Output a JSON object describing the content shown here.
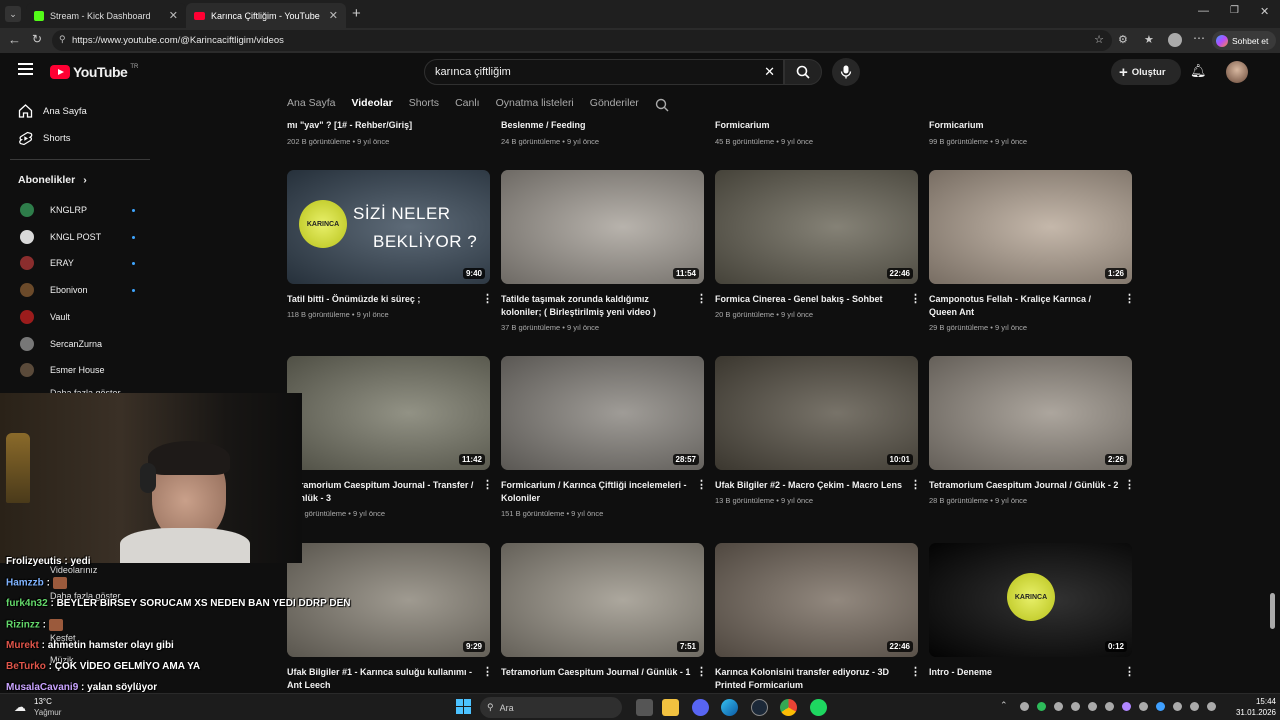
{
  "browser": {
    "tabs": [
      {
        "title": "Stream - Kick Dashboard",
        "active": false
      },
      {
        "title": "Karınca Çiftliğim - YouTube",
        "active": true
      }
    ],
    "url": "https://www.youtube.com/@Karincaciftligim/videos",
    "profile_button": "Sohbet et"
  },
  "masthead": {
    "logo": "YouTube",
    "region": "TR",
    "search_value": "karınca çiftliğim",
    "create_label": "Oluştur"
  },
  "sidebar": {
    "items": [
      {
        "label": "Ana Sayfa"
      },
      {
        "label": "Shorts"
      }
    ],
    "subs_header": "Abonelikler",
    "subs": [
      {
        "name": "KNGLRP",
        "color": "#2e7d4a",
        "dot": true
      },
      {
        "name": "KNGL POST",
        "color": "#d9d9d9",
        "dot": true
      },
      {
        "name": "ERAY",
        "color": "#8a2d2d",
        "dot": true
      },
      {
        "name": "Ebonivon",
        "color": "#6b4a2a",
        "dot": true
      },
      {
        "name": "Vault",
        "color": "#9b1c1c",
        "dot": false
      },
      {
        "name": "SercanZurna",
        "color": "#777777",
        "dot": false
      },
      {
        "name": "Esmer House",
        "color": "#5a4a3a",
        "dot": false
      }
    ],
    "show_more": "Daha fazla göster",
    "lower": [
      "Videolarınız",
      "Daha fazla göster",
      "Keşfet",
      "Müzik"
    ]
  },
  "channel_tabs": [
    "Ana Sayfa",
    "Videolar",
    "Shorts",
    "Canlı",
    "Oynatma listeleri",
    "Gönderiler"
  ],
  "active_tab": "Videolar",
  "top_row": [
    {
      "title": "mı \"yav\" ? [1# - Rehber/Giriş]",
      "meta": "202 B görüntüleme • 9 yıl önce"
    },
    {
      "title": "Beslenme / Feeding",
      "meta": "24 B görüntüleme • 9 yıl önce"
    },
    {
      "title": "Formicarium",
      "meta": "45 B görüntüleme • 9 yıl önce"
    },
    {
      "title": "Formicarium",
      "meta": "99 B görüntüleme • 9 yıl önce"
    }
  ],
  "videos": [
    {
      "title": "Tatil bitti - Önümüzde ki süreç ;",
      "meta": "118 B görüntüleme • 9 yıl önce",
      "duration": "9:40",
      "bg": "#3a4a5a",
      "thumb_text": [
        "SİZİ NELER",
        "BEKLİYOR ?"
      ],
      "logo": "KARINCA"
    },
    {
      "title": "Tatilde taşımak zorunda kaldığımız koloniler; ( Birleştirilmiş yeni video )",
      "meta": "37 B görüntüleme • 9 yıl önce",
      "duration": "11:54",
      "bg": "#a8a29a"
    },
    {
      "title": "Formica Cinerea - Genel bakış - Sohbet",
      "meta": "20 B görüntüleme • 9 yıl önce",
      "duration": "22:46",
      "bg": "#6a6658"
    },
    {
      "title": "Camponotus Fellah - Kraliçe Karınca / Queen Ant",
      "meta": "29 B görüntüleme • 9 yıl önce",
      "duration": "1:26",
      "bg": "#b8a898"
    },
    {
      "title": "Tetramorium Caespitum Journal - Transfer / Günlük - 3",
      "meta": "23 B görüntüleme • 9 yıl önce",
      "duration": "11:42",
      "bg": "#7a7a6a"
    },
    {
      "title": "Formicarium / Karınca Çiftliği incelemeleri - Koloniler",
      "meta": "151 B görüntüleme • 9 yıl önce",
      "duration": "28:57",
      "bg": "#8a8680"
    },
    {
      "title": "Ufak Bilgiler #2 - Macro Çekim - Macro Lens",
      "meta": "13 B görüntüleme • 9 yıl önce",
      "duration": "10:01",
      "bg": "#5a5448"
    },
    {
      "title": "Tetramorium Caespitum Journal / Günlük - 2",
      "meta": "28 B görüntüleme • 9 yıl önce",
      "duration": "2:26",
      "bg": "#9a9288"
    },
    {
      "title": "Ufak Bilgiler #1 - Karınca suluğu kullanımı - Ant Leech",
      "meta": "",
      "duration": "9:29",
      "bg": "#8a8478"
    },
    {
      "title": "Tetramorium Caespitum Journal / Günlük - 1",
      "meta": "",
      "duration": "7:51",
      "bg": "#9a9488"
    },
    {
      "title": "Karınca Kolonisini transfer ediyoruz - 3D Printed Formicarium",
      "meta": "",
      "duration": "22:46",
      "bg": "#7a6e62"
    },
    {
      "title": "Intro - Deneme",
      "meta": "",
      "duration": "0:12",
      "bg": "#050505",
      "logo": "KARINCA"
    }
  ],
  "chat": [
    {
      "user": "Frolizyeutis",
      "color": "#ffffff",
      "msg": "yedi"
    },
    {
      "user": "Hamzzb",
      "color": "#7fb3ff",
      "msg": ""
    },
    {
      "user": "furk4n32",
      "color": "#64d96b",
      "msg": "BEYLER BIRSEY SORUCAM XS NEDEN BAN YEDI DDRP DEN"
    },
    {
      "user": "Rizinzz",
      "color": "#64d96b",
      "msg": ""
    },
    {
      "user": "Murekt",
      "color": "#e0554a",
      "msg": "ahmetin hamster olayı gibi"
    },
    {
      "user": "BeTurko",
      "color": "#e0554a",
      "msg": "ÇOK VİDEO GELMİYO AMA YA"
    },
    {
      "user": "MusalaCavani9",
      "color": "#c9a3ff",
      "msg": "yalan söylüyor"
    }
  ],
  "taskbar": {
    "weather_temp": "13°C",
    "weather_desc": "Yağmur",
    "search": "Ara",
    "time": "15:44",
    "date": "31.01.2026"
  }
}
